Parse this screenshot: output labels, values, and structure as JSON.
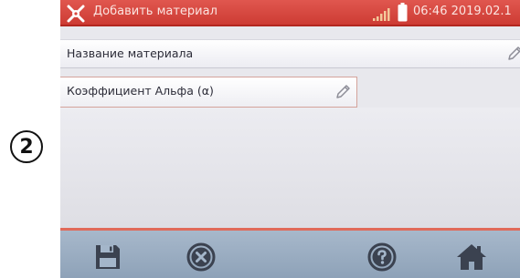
{
  "step": {
    "number": "2"
  },
  "header": {
    "title": "Добавить материал",
    "datetime": "06:46 2019.02.1",
    "icons": {
      "app": "settings-tools-icon",
      "signal": "signal-strength-icon",
      "battery": "battery-icon"
    }
  },
  "fields": {
    "material_name": {
      "label": "Название материала",
      "icon": "pencil-edit-icon"
    },
    "alpha_coefficient": {
      "label": "Коэффициент Альфа (α)",
      "icon": "pencil-edit-icon"
    }
  },
  "toolbar": {
    "buttons": [
      {
        "icon": "save-icon"
      },
      {
        "icon": "cancel-icon"
      },
      {
        "icon": "help-icon"
      },
      {
        "icon": "home-icon"
      }
    ]
  },
  "colors": {
    "header": "#d9463e",
    "toolbar": "#9aaec2",
    "toolbar_accent": "#e06a5a",
    "icon_dark": "#3b4250"
  }
}
